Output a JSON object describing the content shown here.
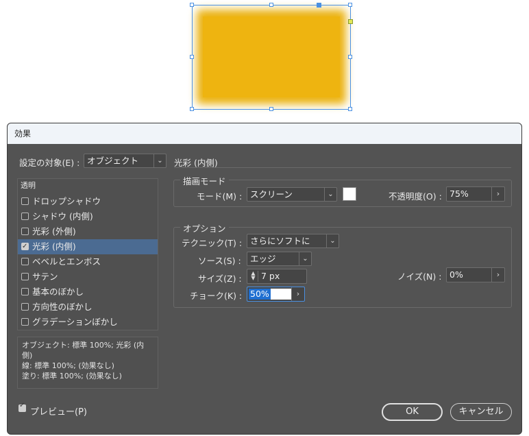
{
  "dialog": {
    "title": "効果",
    "target_label": "設定の対象(E) :",
    "target_value": "オブジェクト",
    "section_title": "光彩 (内側)",
    "effects_list": [
      {
        "label": "透明",
        "header": true
      },
      {
        "label": "ドロップシャドウ",
        "checked": false
      },
      {
        "label": "シャドウ (内側)",
        "checked": false
      },
      {
        "label": "光彩 (外側)",
        "checked": false
      },
      {
        "label": "光彩 (内側)",
        "checked": true,
        "selected": true
      },
      {
        "label": "ベベルとエンボス",
        "checked": false
      },
      {
        "label": "サテン",
        "checked": false
      },
      {
        "label": "基本のぼかし",
        "checked": false
      },
      {
        "label": "方向性のぼかし",
        "checked": false
      },
      {
        "label": "グラデーションぼかし",
        "checked": false
      }
    ],
    "summary": {
      "line1": "オブジェクト: 標準 100%; 光彩 (内",
      "line2": "側)",
      "line3": "線: 標準 100%; (効果なし)",
      "line4": "塗り: 標準 100%; (効果なし)"
    },
    "blend_group": {
      "title": "描画モード",
      "mode_label": "モード(M) :",
      "mode_value": "スクリーン",
      "swatch_color": "#ffffff",
      "opacity_label": "不透明度(O) :",
      "opacity_value": "75%"
    },
    "options_group": {
      "title": "オプション",
      "technique_label": "テクニック(T) :",
      "technique_value": "さらにソフトに",
      "source_label": "ソース(S) :",
      "source_value": "エッジ",
      "size_label": "サイズ(Z) :",
      "size_value": "7 px",
      "choke_label": "チョーク(K) :",
      "choke_value": "50%",
      "noise_label": "ノイズ(N) :",
      "noise_value": "0%"
    },
    "preview_label": "プレビュー(P)",
    "preview_checked": true,
    "ok_label": "OK",
    "cancel_label": "キャンセル"
  },
  "canvas": {
    "shape_color": "#eeb410"
  }
}
